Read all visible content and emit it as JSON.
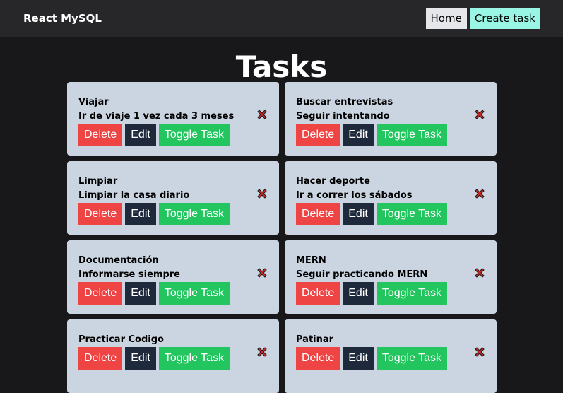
{
  "navbar": {
    "brand": "React MySQL",
    "home_label": "Home",
    "create_label": "Create task"
  },
  "page": {
    "title": "Tasks"
  },
  "buttons": {
    "delete": "Delete",
    "edit": "Edit",
    "toggle": "Toggle Task"
  },
  "colors": {
    "delete": "#ef4444",
    "edit": "#1e293b",
    "toggle": "#22c55e",
    "card": "#cbd5e1",
    "create": "#99f6e4"
  },
  "tasks": [
    {
      "title": "Viajar",
      "description": "Ir de viaje 1 vez cada 3 meses",
      "status_icon": "cross-mark-icon"
    },
    {
      "title": "Buscar entrevistas",
      "description": "Seguir intentando",
      "status_icon": "cross-mark-icon"
    },
    {
      "title": "Limpiar",
      "description": "Limpiar la casa diario",
      "status_icon": "cross-mark-icon"
    },
    {
      "title": "Hacer deporte",
      "description": "Ir a correr los sábados",
      "status_icon": "cross-mark-icon"
    },
    {
      "title": "Documentación",
      "description": "Informarse siempre",
      "status_icon": "cross-mark-icon"
    },
    {
      "title": "MERN",
      "description": "Seguir practicando MERN",
      "status_icon": "cross-mark-icon"
    },
    {
      "title": "Practicar Codigo",
      "description": "",
      "status_icon": "cross-mark-icon"
    },
    {
      "title": "Patinar",
      "description": "",
      "status_icon": "cross-mark-icon"
    }
  ]
}
